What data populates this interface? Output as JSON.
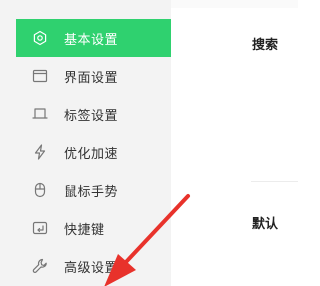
{
  "sidebar": {
    "items": [
      {
        "label": "基本设置",
        "icon": "hexagon-settings-icon",
        "active": true
      },
      {
        "label": "界面设置",
        "icon": "window-icon",
        "active": false
      },
      {
        "label": "标签设置",
        "icon": "tab-icon",
        "active": false
      },
      {
        "label": "优化加速",
        "icon": "lightning-icon",
        "active": false
      },
      {
        "label": "鼠标手势",
        "icon": "mouse-icon",
        "active": false
      },
      {
        "label": "快捷键",
        "icon": "keyboard-shortcut-icon",
        "active": false
      },
      {
        "label": "高级设置",
        "icon": "wrench-icon",
        "active": false
      }
    ],
    "active_color": "#2fd16f"
  },
  "main": {
    "sections": [
      {
        "label": "搜索"
      },
      {
        "label": "默认"
      }
    ]
  },
  "annotation": {
    "arrow_color": "#e8322b"
  }
}
